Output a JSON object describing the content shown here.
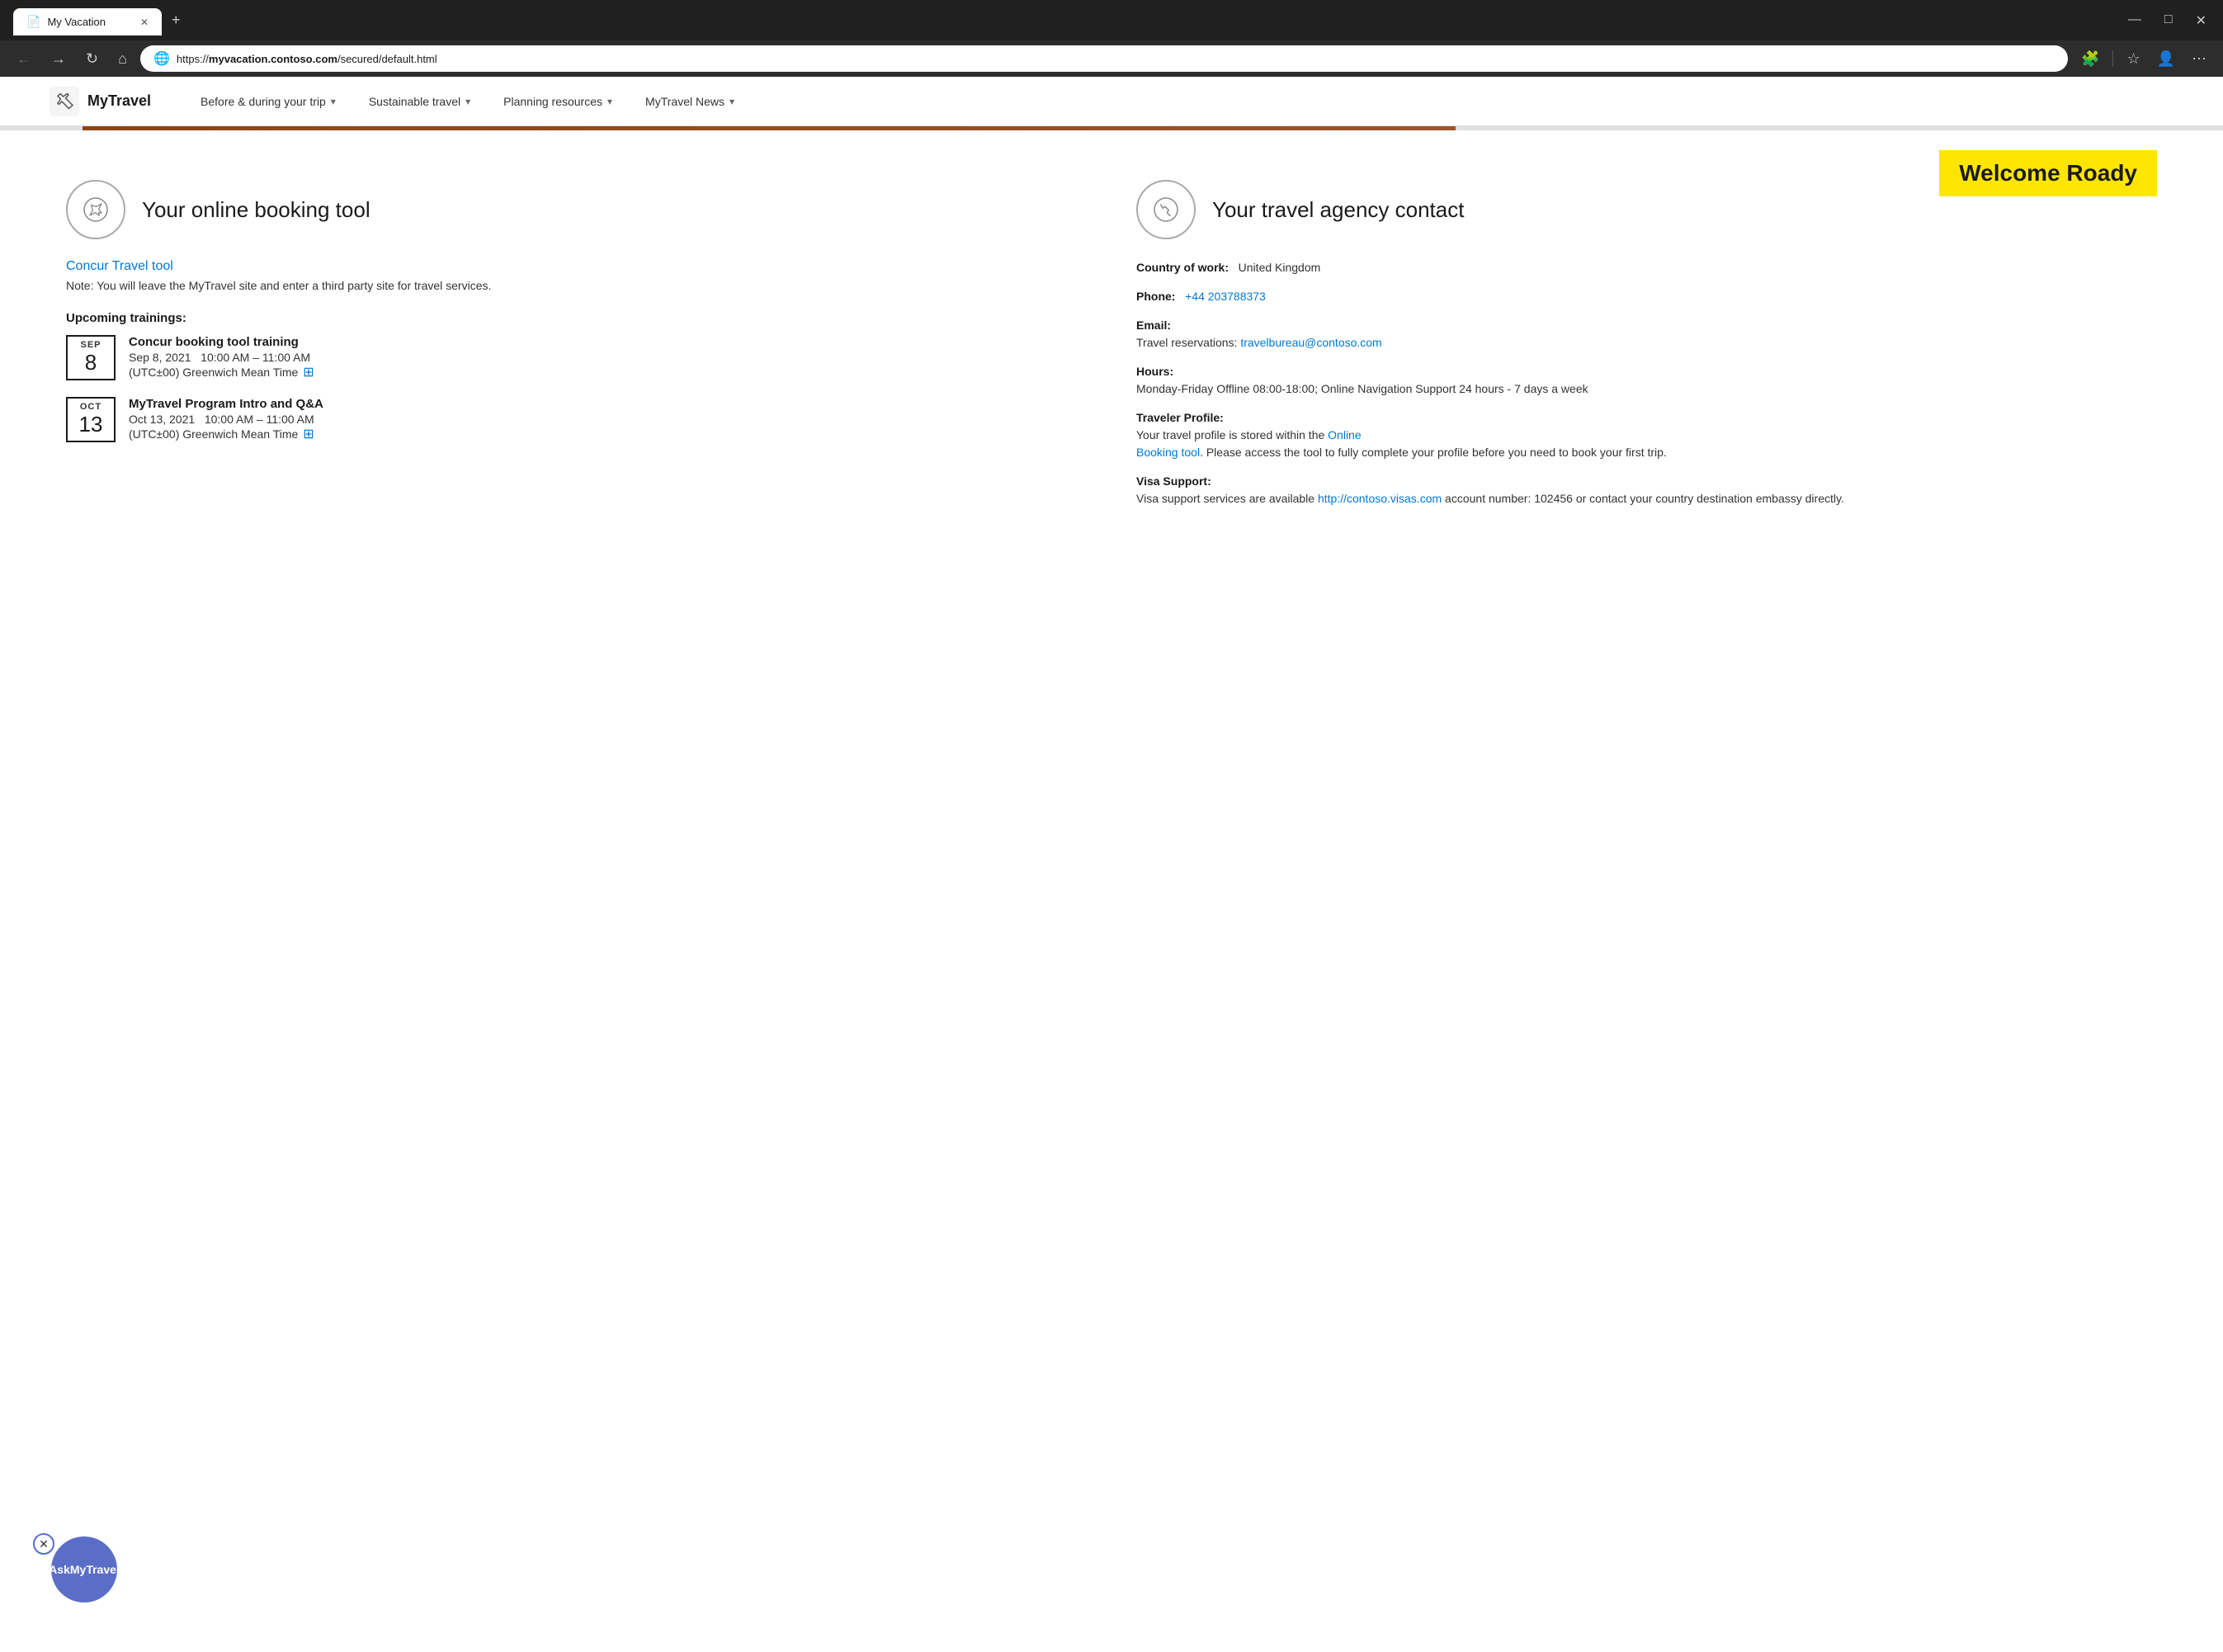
{
  "browser": {
    "tab": {
      "title": "My Vacation",
      "favicon": "📄"
    },
    "new_tab_icon": "+",
    "window_controls": {
      "minimize": "—",
      "maximize": "□",
      "close": "✕"
    },
    "nav": {
      "back": "←",
      "forward": "→",
      "reload": "↻",
      "home": "⌂"
    },
    "address": {
      "full": "https://myvacation.contoso.com/secured/default.html",
      "domain": "myvacation.contoso.com",
      "path": "/secured/default.html"
    },
    "toolbar_icons": [
      "🧩",
      "☆",
      "👤",
      "⋯"
    ]
  },
  "site": {
    "logo_text": "MyTravel",
    "logo_icon": "✈",
    "nav": [
      {
        "label": "Before & during your trip",
        "has_dropdown": true
      },
      {
        "label": "Sustainable travel",
        "has_dropdown": true
      },
      {
        "label": "Planning resources",
        "has_dropdown": true
      },
      {
        "label": "MyTravel News",
        "has_dropdown": true
      }
    ]
  },
  "welcome": {
    "text": "Welcome Roady"
  },
  "booking_section": {
    "title": "Your online booking tool",
    "link_label": "Concur Travel tool",
    "link_url": "#",
    "note": "Note: You will leave the MyTravel site and enter a third party site for travel services.",
    "trainings_label": "Upcoming trainings:",
    "events": [
      {
        "month": "SEP",
        "day": "8",
        "title": "Concur booking tool training",
        "date": "Sep 8, 2021",
        "time": "10:00 AM – 11:00 AM",
        "timezone": "(UTC±00) Greenwich Mean Time"
      },
      {
        "month": "OCT",
        "day": "13",
        "title": "MyTravel Program Intro and Q&A",
        "date": "Oct 13, 2021",
        "time": "10:00 AM – 11:00 AM",
        "timezone": "(UTC±00) Greenwich Mean Time"
      }
    ]
  },
  "agency_section": {
    "title": "Your travel agency contact",
    "country_label": "Country of work:",
    "country_value": "United Kingdom",
    "phone_label": "Phone:",
    "phone_value": "+44 203788373",
    "phone_url": "tel:+44203788373",
    "email_label": "Email:",
    "email_sublabel": "Travel reservations:",
    "email_value": "travelbureau@contoso.com",
    "hours_label": "Hours:",
    "hours_value": "Monday-Friday Offline 08:00-18:00; Online Navigation Support 24 hours - 7 days a week",
    "profile_label": "Traveler Profile:",
    "profile_text_before": "Your travel profile is stored within the ",
    "profile_link_label": "Online Booking tool",
    "profile_text_after": ". Please access the tool to fully complete your profile before you need to book your first trip.",
    "visa_label": "Visa Support:",
    "visa_text_before": "Visa support services are available ",
    "visa_link": "http://contoso.visas.com",
    "visa_text_after": " account number: 102456 or contact your country destination embassy directly."
  },
  "ask_widget": {
    "close_icon": "✕",
    "label_line1": "Ask",
    "label_line2": "MyTravel"
  }
}
